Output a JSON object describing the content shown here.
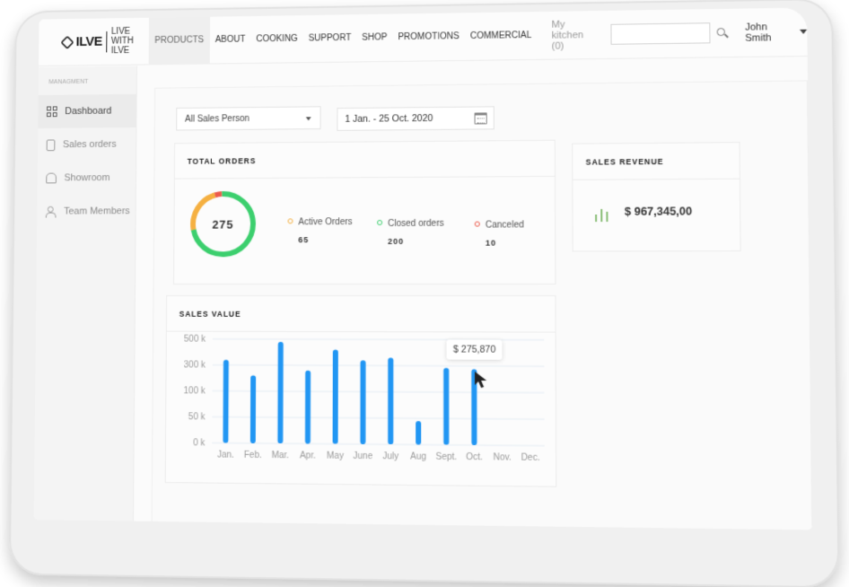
{
  "header": {
    "logo_text": "ILVE",
    "logo_tagline": "LIVE WITH ILVE",
    "nav": [
      {
        "label": "PRODUCTS",
        "active": true
      },
      {
        "label": "ABOUT",
        "active": false
      },
      {
        "label": "COOKING",
        "active": false
      },
      {
        "label": "SUPPORT",
        "active": false
      },
      {
        "label": "SHOP",
        "active": false
      },
      {
        "label": "PROMOTIONS",
        "active": false
      },
      {
        "label": "COMMERCIAL",
        "active": false
      }
    ],
    "kitchen_link": "My kitchen (0)",
    "search_value": "",
    "search_icon": "search-icon",
    "user_name": "John Smith",
    "user_menu_icon": "caret-down-icon"
  },
  "sidebar": {
    "heading": "MANAGMENT",
    "items": [
      {
        "label": "Dashboard",
        "icon": "grid-icon",
        "active": true
      },
      {
        "label": "Sales orders",
        "icon": "shopping-bag-icon",
        "active": false
      },
      {
        "label": "Showroom",
        "icon": "home-icon",
        "active": false
      },
      {
        "label": "Team Members",
        "icon": "users-icon",
        "active": false
      }
    ]
  },
  "filters": {
    "sales_person": "All Sales Person",
    "date_range": "1 Jan. - 25 Oct. 2020",
    "calendar_icon": "calendar-icon"
  },
  "total_orders": {
    "title": "TOTAL ORDERS",
    "total": "275",
    "legend": [
      {
        "label": "Active Orders",
        "value": "65",
        "color": "#f5b041"
      },
      {
        "label": "Closed orders",
        "value": "200",
        "color": "#3ccf6e"
      },
      {
        "label": "Canceled",
        "value": "10",
        "color": "#ec5b4c"
      }
    ]
  },
  "sales_revenue": {
    "title": "SALES REVENUE",
    "value": "$ 967,345,00",
    "icon": "bar-chart-icon",
    "icon_color": "#8cbf7a"
  },
  "sales_value": {
    "title": "SALES VALUE",
    "tooltip": "$ 275,870",
    "bar_color": "#2196f3"
  },
  "chart_data": {
    "type": "bar",
    "title": "SALES VALUE",
    "xlabel": "",
    "ylabel": "",
    "categories": [
      "Jan.",
      "Feb.",
      "Mar.",
      "Apr.",
      "May",
      "June",
      "July",
      "Aug",
      "Sept.",
      "Oct.",
      "Nov.",
      "Dec."
    ],
    "values": [
      340000,
      220000,
      480000,
      260000,
      420000,
      340000,
      360000,
      45000,
      285000,
      275870,
      null,
      null
    ],
    "y_ticks": [
      0,
      50000,
      100000,
      300000,
      500000
    ],
    "y_tick_labels": [
      "0 k",
      "50 k",
      "100 k",
      "300 k",
      "500 k"
    ],
    "y_scale": "ordinal-ticks (evenly spaced non-linear labels)",
    "ylim": [
      0,
      500000
    ],
    "grid": true,
    "highlight": {
      "category": "Oct.",
      "label": "$ 275,870"
    }
  }
}
